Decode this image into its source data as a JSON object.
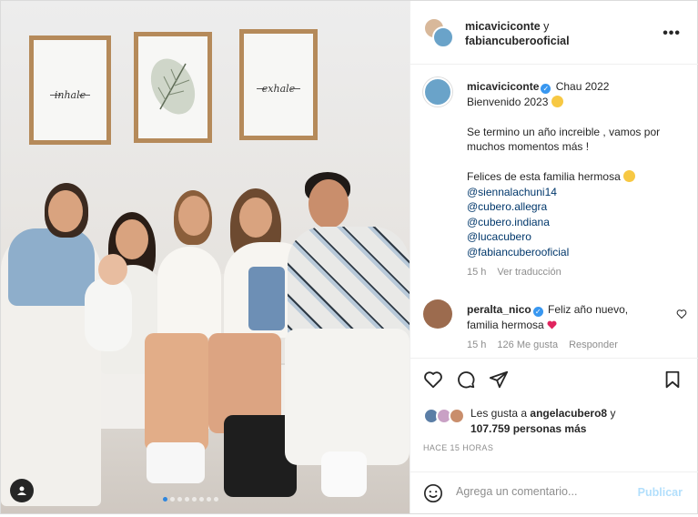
{
  "post": {
    "image_alt": "",
    "poster_left_text": "inhale",
    "poster_right_text": "exhale"
  },
  "header": {
    "user1": "micaviciconte",
    "connector": "y",
    "user2": "fabiancuberooficial",
    "more_icon": "more-horizontal-icon"
  },
  "caption": {
    "username": "micaviciconte",
    "line1": "Chau 2022",
    "line2": "Bienvenido 2023",
    "para1": "Se termino un año increible , vamos por muchos momentos más !",
    "para2": "Felices de esta familia hermosa",
    "mentions": [
      "@siennalachuni14",
      "@cubero.allegra",
      "@cubero.indiana",
      "@lucacubero",
      "@fabiancuberooficial"
    ],
    "time": "15 h",
    "translate": "Ver traducción"
  },
  "comment": {
    "username": "peralta_nico",
    "text": "Feliz año nuevo, familia hermosa",
    "time": "15 h",
    "likes": "126 Me gusta",
    "reply": "Responder"
  },
  "likes": {
    "prefix": "Les gusta a",
    "user": "angelacubero8",
    "connector": "y",
    "count": "107.759 personas más"
  },
  "time_ago": "HACE 15 HORAS",
  "comment_box": {
    "placeholder": "Agrega un comentario...",
    "publish": "Publicar"
  },
  "colors": {
    "verified": "#3897f0",
    "mention": "#00376b",
    "publish_disabled": "#b2dffc",
    "muted": "#8e8e8e"
  }
}
